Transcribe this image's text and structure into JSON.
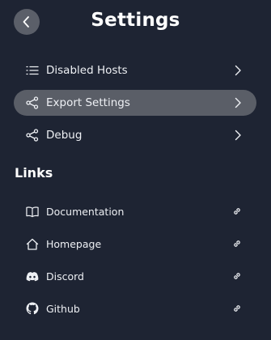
{
  "header": {
    "title": "Settings",
    "back_icon": "chevron-left-icon"
  },
  "settings_items": [
    {
      "label": "Disabled Hosts",
      "icon": "list-icon",
      "active": false
    },
    {
      "label": "Export Settings",
      "icon": "share-icon",
      "active": true
    },
    {
      "label": "Debug",
      "icon": "share-icon",
      "active": false
    }
  ],
  "links_section": {
    "title": "Links",
    "items": [
      {
        "label": "Documentation",
        "icon": "book-icon"
      },
      {
        "label": "Homepage",
        "icon": "home-icon"
      },
      {
        "label": "Discord",
        "icon": "discord-icon"
      },
      {
        "label": "Github",
        "icon": "github-icon"
      }
    ]
  },
  "colors": {
    "background": "#1e2433",
    "active_row": "#5a5e67",
    "back_button": "#5b5f69",
    "text": "#eef0f4"
  }
}
